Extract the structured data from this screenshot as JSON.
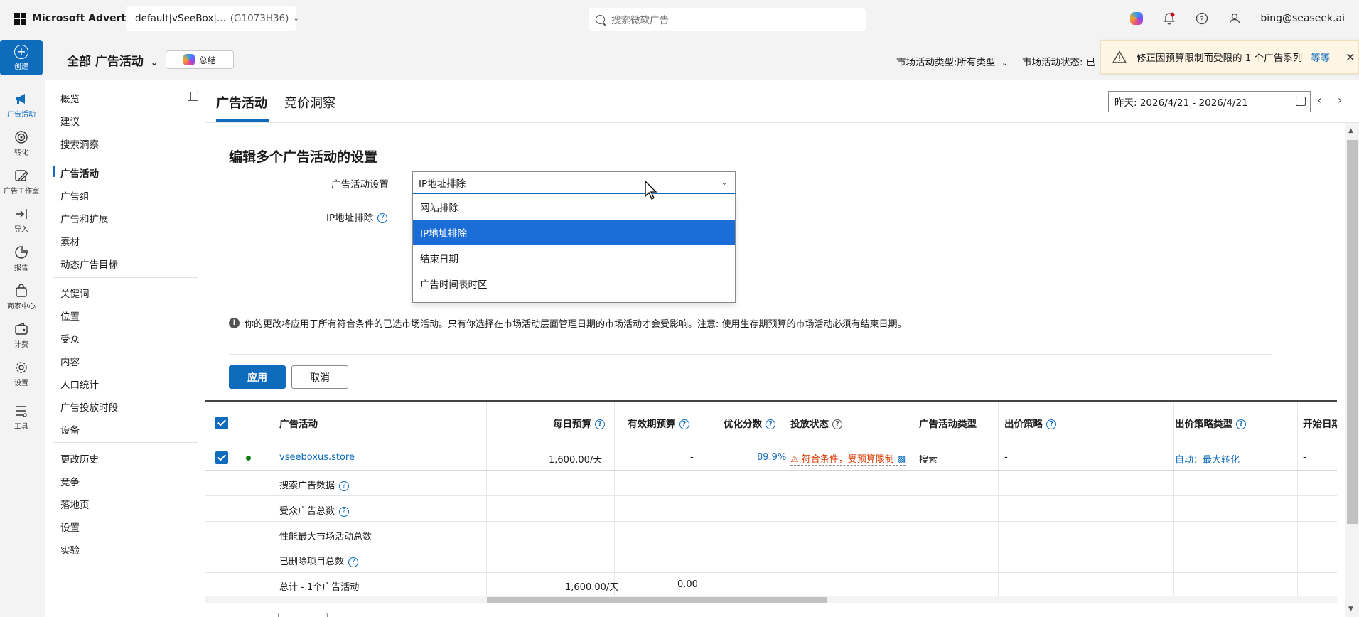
{
  "topbar": {
    "brand": "Microsoft Advertising",
    "account_name": "default|vSeeBox|...",
    "account_id": "(G1073H36)",
    "search_placeholder": "搜索微软广告",
    "user_email": "bing@seaseek.ai"
  },
  "rail": {
    "create": "创建",
    "items": [
      "广告活动",
      "转化",
      "广告工作室",
      "导入",
      "报告",
      "商家中心",
      "计费",
      "设置",
      "工具"
    ]
  },
  "header2": {
    "scope": "全部 广告活动",
    "summary": "总结",
    "campaign_type_filter": "市场活动类型:所有类型",
    "campaign_status_filter": "市场活动状态: 已"
  },
  "notice": {
    "text": "修正因预算限制而受限的 1 个广告系列",
    "more": "等等"
  },
  "leftnav": {
    "items": [
      "概览",
      "建议",
      "搜索洞察",
      "广告活动",
      "广告组",
      "广告和扩展",
      "素材",
      "动态广告目标",
      "关键词",
      "位置",
      "受众",
      "内容",
      "人口统计",
      "广告投放时段",
      "设备",
      "更改历史",
      "竞争",
      "落地页",
      "设置",
      "实验"
    ]
  },
  "tabs": [
    "广告活动",
    "竞价洞察"
  ],
  "date_range": "昨天: 2026/4/21 - 2026/4/21",
  "edit": {
    "title": "编辑多个广告活动的设置",
    "setting_label": "广告活动设置",
    "setting_value": "IP地址排除",
    "ip_label": "IP地址排除",
    "options": [
      "网站排除",
      "IP地址排除",
      "结束日期",
      "广告时间表时区"
    ],
    "info": "你的更改将应用于所有符合条件的已选市场活动。只有你选择在市场活动层面管理日期的市场活动才会受影响。注意: 使用生存期预算的市场活动必须有结束日期。",
    "apply": "应用",
    "cancel": "取消"
  },
  "table": {
    "headers": [
      "广告活动",
      "每日预算",
      "有效期预算",
      "优化分数",
      "投放状态",
      "广告活动类型",
      "出价策略",
      "出价策略类型",
      "开始日期"
    ],
    "row": {
      "campaign": "vseeboxus.store",
      "daily_budget": "1,600.00/天",
      "lifetime_budget": "-",
      "opt_score": "89.9%",
      "delivery": "符合条件，受预算限制",
      "type": "搜索",
      "bid_strategy": "-",
      "bid_strategy_type": "自动：最大转化",
      "start_date": "-"
    },
    "summary_rows": [
      "搜索广告数据",
      "受众广告总数",
      "性能最大市场活动总数",
      "已删除项目总数"
    ],
    "total_label": "总计 - 1个广告活动",
    "total_daily": "1,600.00/天",
    "total_lifetime": "0.00"
  }
}
